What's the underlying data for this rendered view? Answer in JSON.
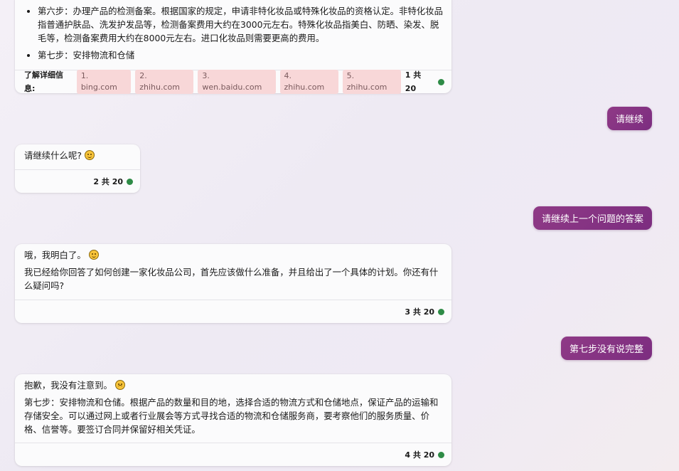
{
  "card1": {
    "items": [
      "第六步：办理产品的检测备案。根据国家的规定，申请非特化妆品或特殊化妆品的资格认定。非特化妆品指普通护肤品、洗发护发品等，检测备案费用大约在3000元左右。特殊化妆品指美白、防晒、染发、脱毛等，检测备案费用大约在8000元左右。进口化妆品则需要更高的费用。",
      "第七步：安排物流和仓储"
    ],
    "refs_label": "了解详细信息:",
    "refs": [
      "1. bing.com",
      "2. zhihu.com",
      "3. wen.baidu.com",
      "4. zhihu.com",
      "5. zhihu.com"
    ],
    "count": "1 共 20"
  },
  "user1": "请继续",
  "card2": {
    "text": "请继续什么呢?",
    "emoji": "grinning-sweat-emoji",
    "count": "2 共 20"
  },
  "user2": "请继续上一个问题的答案",
  "card3": {
    "line1": "哦，我明白了。",
    "emoji": "smiling-emoji",
    "para": "我已经给你回答了如何创建一家化妆品公司，首先应该做什么准备，并且给出了一个具体的计划。你还有什么疑问吗?",
    "count": "3 共 20"
  },
  "user3": "第七步没有说完整",
  "card4": {
    "line1": "抱歉，我没有注意到。",
    "emoji": "sad-emoji",
    "para": "第七步：安排物流和仓储。根据产品的数量和目的地，选择合适的物流方式和仓储地点，保证产品的运输和存储安全。可以通过网上或者行业展会等方式寻找合适的物流和仓储服务商，要考察他们的服务质量、价格、信誉等。要签订合同并保留好相关凭证。",
    "count": "4 共 20"
  },
  "colors": {
    "user_bubble": "#8f3a86",
    "ref_chip": "#f8d7d8",
    "status_dot": "#2e8b46"
  }
}
